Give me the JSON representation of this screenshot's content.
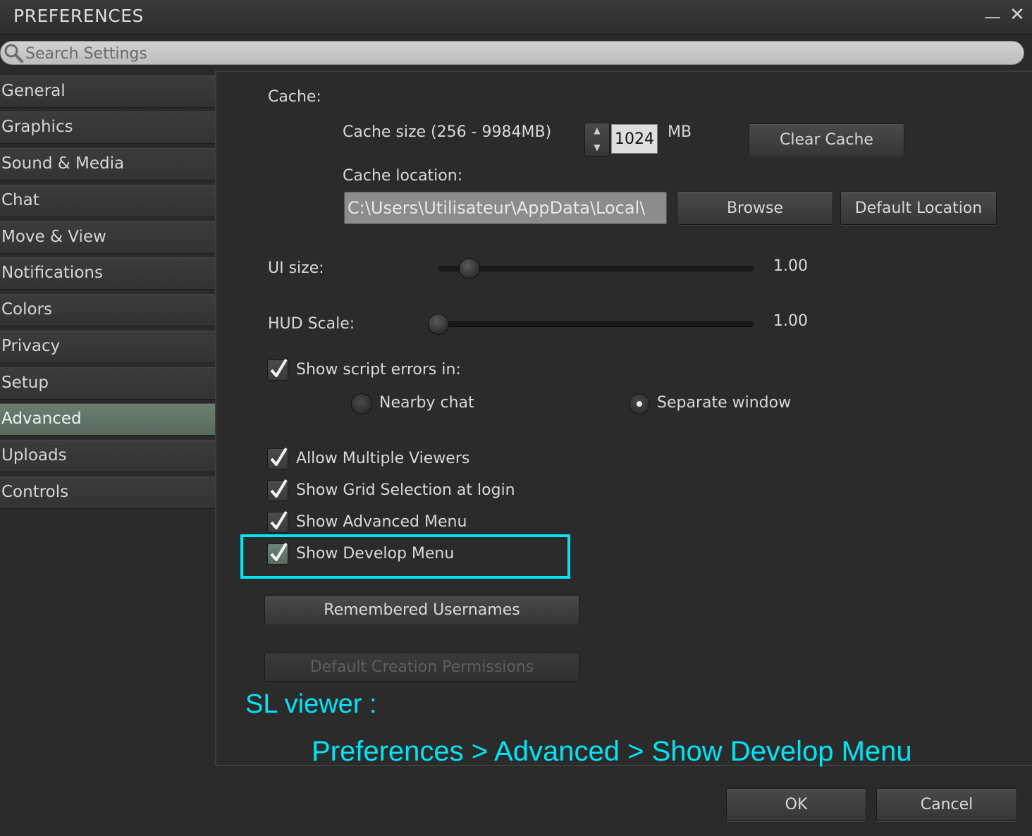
{
  "window": {
    "title": "PREFERENCES",
    "minimize_icon": "minimize-icon",
    "close_icon": "close-icon"
  },
  "search": {
    "placeholder": "Search Settings",
    "value": ""
  },
  "sidebar": {
    "items": [
      {
        "label": "General"
      },
      {
        "label": "Graphics"
      },
      {
        "label": "Sound & Media"
      },
      {
        "label": "Chat"
      },
      {
        "label": "Move & View"
      },
      {
        "label": "Notifications"
      },
      {
        "label": "Colors"
      },
      {
        "label": "Privacy"
      },
      {
        "label": "Setup"
      },
      {
        "label": "Advanced",
        "active": true
      },
      {
        "label": "Uploads"
      },
      {
        "label": "Controls"
      }
    ]
  },
  "advanced": {
    "cache_heading": "Cache:",
    "cache_size_label": "Cache size (256 - 9984MB)",
    "cache_size_value": "1024",
    "cache_size_unit": "MB",
    "clear_cache_label": "Clear Cache",
    "cache_location_label": "Cache location:",
    "cache_location_value": "C:\\Users\\Utilisateur\\AppData\\Local\\",
    "browse_label": "Browse",
    "default_location_label": "Default Location",
    "ui_size_label": "UI size:",
    "ui_size_value": "1.00",
    "ui_size_level": 0.07,
    "hud_scale_label": "HUD Scale:",
    "hud_scale_value": "1.00",
    "hud_scale_level": 0.0,
    "show_script_errors_label": "Show script errors in:",
    "show_script_errors_checked": true,
    "nearby_chat_label": "Nearby chat",
    "separate_window_label": "Separate window",
    "selected_error_target": "Separate window",
    "allow_multiple_viewers_label": "Allow Multiple Viewers",
    "show_grid_selection_label": "Show Grid Selection at login",
    "show_advanced_menu_label": "Show Advanced Menu",
    "show_develop_menu_label": "Show Develop Menu",
    "remembered_usernames_label": "Remembered Usernames",
    "default_creation_permissions_label": "Default Creation Permissions"
  },
  "annotation": {
    "line1": "SL viewer :",
    "line2": "Preferences > Advanced > Show Develop Menu",
    "color": "#00e5f5"
  },
  "footer": {
    "ok_label": "OK",
    "cancel_label": "Cancel"
  },
  "colors": {
    "active_tab": "#5f7367",
    "highlight": "#00e5f5"
  }
}
